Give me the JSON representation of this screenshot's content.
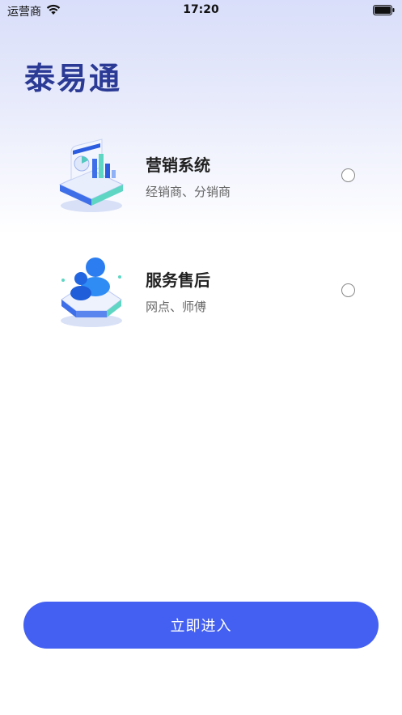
{
  "status_bar": {
    "carrier": "运营商",
    "time": "17:20",
    "icons": [
      "wifi-icon",
      "battery-icon"
    ]
  },
  "app": {
    "title": "泰易通",
    "accent_color": "#4360f2",
    "title_color": "#2b3b95"
  },
  "options": [
    {
      "icon": "marketing-system-illustration",
      "title": "营销系统",
      "subtitle": "经销商、分销商",
      "selected": false
    },
    {
      "icon": "after-sales-service-illustration",
      "title": "服务售后",
      "subtitle": "网点、师傅",
      "selected": false
    }
  ],
  "actions": {
    "enter_label": "立即进入"
  }
}
